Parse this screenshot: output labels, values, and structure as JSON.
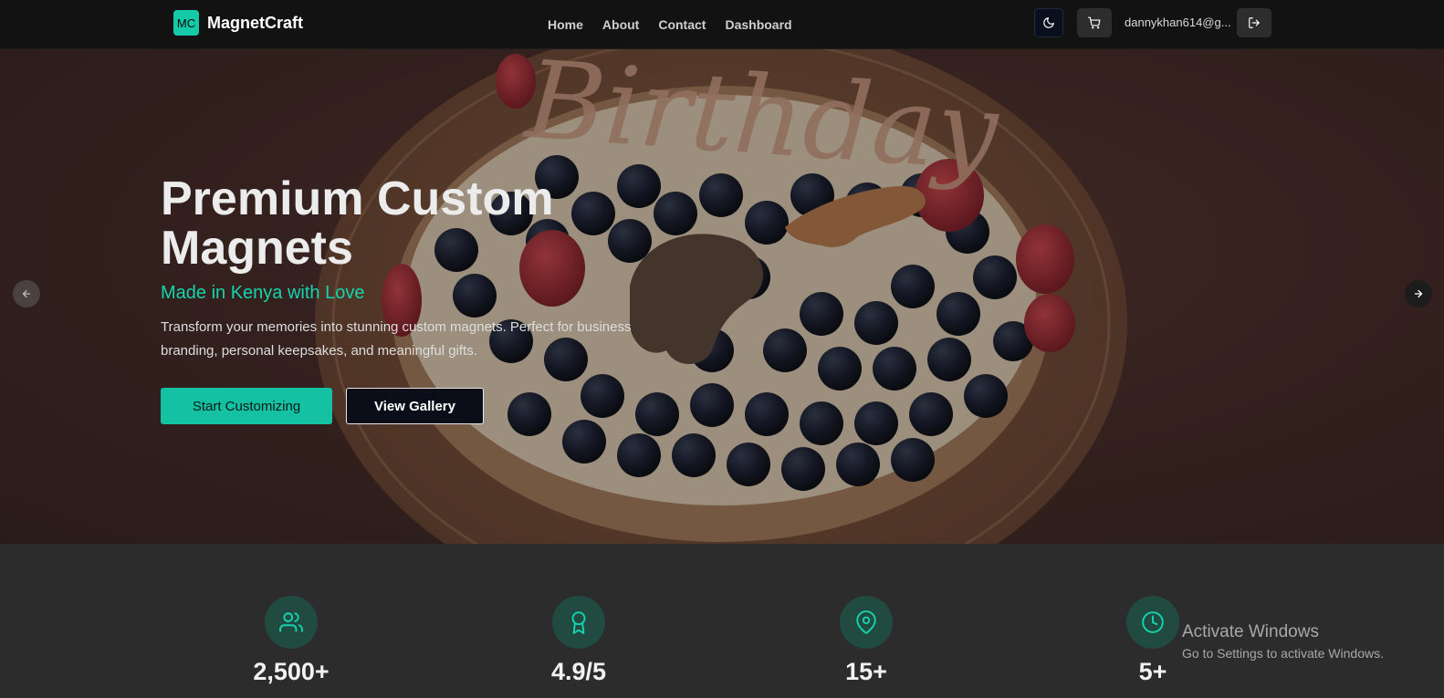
{
  "navbar": {
    "brand_logo_text": "MC",
    "brand_name": "MagnetCraft",
    "links": [
      "Home",
      "About",
      "Contact",
      "Dashboard"
    ],
    "user_email": "dannykhan614@g..."
  },
  "hero": {
    "background_image_text": "Birthday",
    "title": "Premium Custom Magnets",
    "subtitle": "Made in Kenya with Love",
    "description": "Transform your memories into stunning custom magnets. Perfect for business branding, personal keepsakes, and meaningful gifts.",
    "primary_button": "Start Customizing",
    "secondary_button": "View Gallery"
  },
  "stats": [
    {
      "icon": "users-icon",
      "value": "2,500+"
    },
    {
      "icon": "award-icon",
      "value": "4.9/5"
    },
    {
      "icon": "map-pin-icon",
      "value": "15+"
    },
    {
      "icon": "clock-icon",
      "value": "5+"
    }
  ],
  "watermark": {
    "title": "Activate Windows",
    "subtitle": "Go to Settings to activate Windows."
  },
  "colors": {
    "accent": "#14c2a3",
    "navbar_bg": "#121212",
    "stats_bg": "#2c2c2c",
    "icon_circle_bg": "#214a41"
  }
}
